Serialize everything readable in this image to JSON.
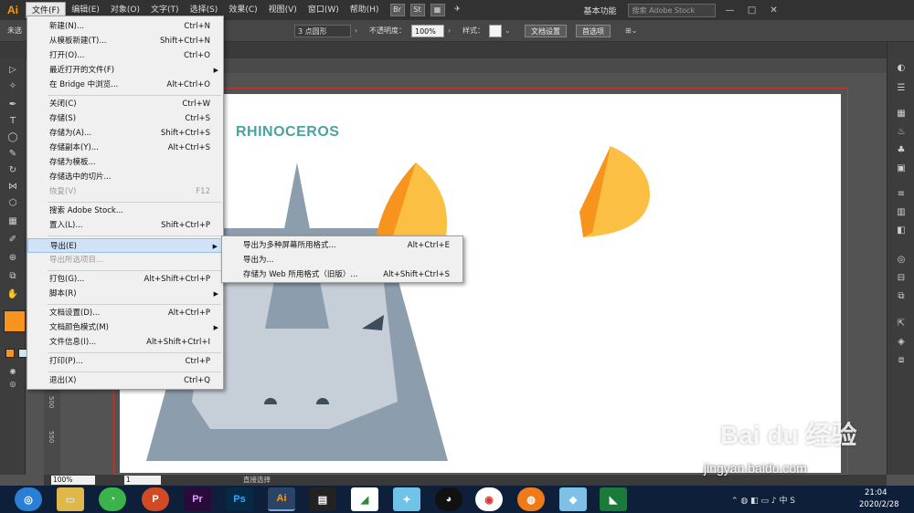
{
  "app": {
    "logo": "Ai"
  },
  "menubar": {
    "items": [
      "文件(F)",
      "编辑(E)",
      "对象(O)",
      "文字(T)",
      "选择(S)",
      "效果(C)",
      "视图(V)",
      "窗口(W)",
      "帮助(H)"
    ],
    "br": "Br",
    "st": "St",
    "workspace": "基本功能",
    "stock_placeholder": "搜索 Adobe Stock",
    "win_controls": [
      "—",
      "□",
      "✕"
    ]
  },
  "controlbar": {
    "unselected": "未选",
    "stroke_size": "3 点圆形",
    "opacity_label": "不透明度：",
    "opacity_value": "100%",
    "style_label": "样式：",
    "doc_setup": "文档设置",
    "preferences": "首选项"
  },
  "file_menu": {
    "items": [
      {
        "label": "新建(N)...",
        "shortcut": "Ctrl+N"
      },
      {
        "label": "从模板新建(T)...",
        "shortcut": "Shift+Ctrl+N"
      },
      {
        "label": "打开(O)...",
        "shortcut": "Ctrl+O"
      },
      {
        "label": "最近打开的文件(F)",
        "shortcut": ""
      },
      {
        "label": "在 Bridge 中浏览...",
        "shortcut": "Alt+Ctrl+O"
      },
      {
        "label": "关闭(C)",
        "shortcut": "Ctrl+W"
      },
      {
        "label": "存储(S)",
        "shortcut": "Ctrl+S"
      },
      {
        "label": "存储为(A)...",
        "shortcut": "Shift+Ctrl+S"
      },
      {
        "label": "存储副本(Y)...",
        "shortcut": "Alt+Ctrl+S"
      },
      {
        "label": "存储为模板...",
        "shortcut": ""
      },
      {
        "label": "存储选中的切片...",
        "shortcut": ""
      },
      {
        "label": "恢复(V)",
        "shortcut": "F12"
      },
      {
        "label": "搜索 Adobe Stock...",
        "shortcut": ""
      },
      {
        "label": "置入(L)...",
        "shortcut": "Shift+Ctrl+P"
      },
      {
        "label": "导出(E)",
        "shortcut": ""
      },
      {
        "label": "导出所选项目...",
        "shortcut": ""
      },
      {
        "label": "打包(G)...",
        "shortcut": "Alt+Shift+Ctrl+P"
      },
      {
        "label": "脚本(R)",
        "shortcut": ""
      },
      {
        "label": "文档设置(D)...",
        "shortcut": "Alt+Ctrl+P"
      },
      {
        "label": "文档颜色模式(M)",
        "shortcut": ""
      },
      {
        "label": "文件信息(I)...",
        "shortcut": "Alt+Shift+Ctrl+I"
      },
      {
        "label": "打印(P)...",
        "shortcut": "Ctrl+P"
      },
      {
        "label": "退出(X)",
        "shortcut": "Ctrl+Q"
      }
    ]
  },
  "export_submenu": {
    "items": [
      {
        "label": "导出为多种屏幕所用格式...",
        "shortcut": "Alt+Ctrl+E"
      },
      {
        "label": "导出为...",
        "shortcut": ""
      },
      {
        "label": "存储为 Web 所用格式（旧版）...",
        "shortcut": "Alt+Shift+Ctrl+S"
      }
    ]
  },
  "artboard": {
    "title": "RHINOCEROS"
  },
  "statusbar": {
    "zoom": "100%",
    "page": "1",
    "tool": "直接选择"
  },
  "ruler": {
    "labels": [
      "500",
      "550"
    ]
  },
  "taskbar": {
    "time": "21:04",
    "date": "2020/2/28",
    "apps": [
      "Pr",
      "Ps",
      "Ai"
    ]
  },
  "watermark": {
    "brand": "Bai du 经验",
    "url": "jingyan.baidu.com"
  },
  "colors": {
    "fill": "#f7941d",
    "rhino": "#8c9eae",
    "title": "#4aa3a0",
    "highlight": "#cfe2f7"
  }
}
